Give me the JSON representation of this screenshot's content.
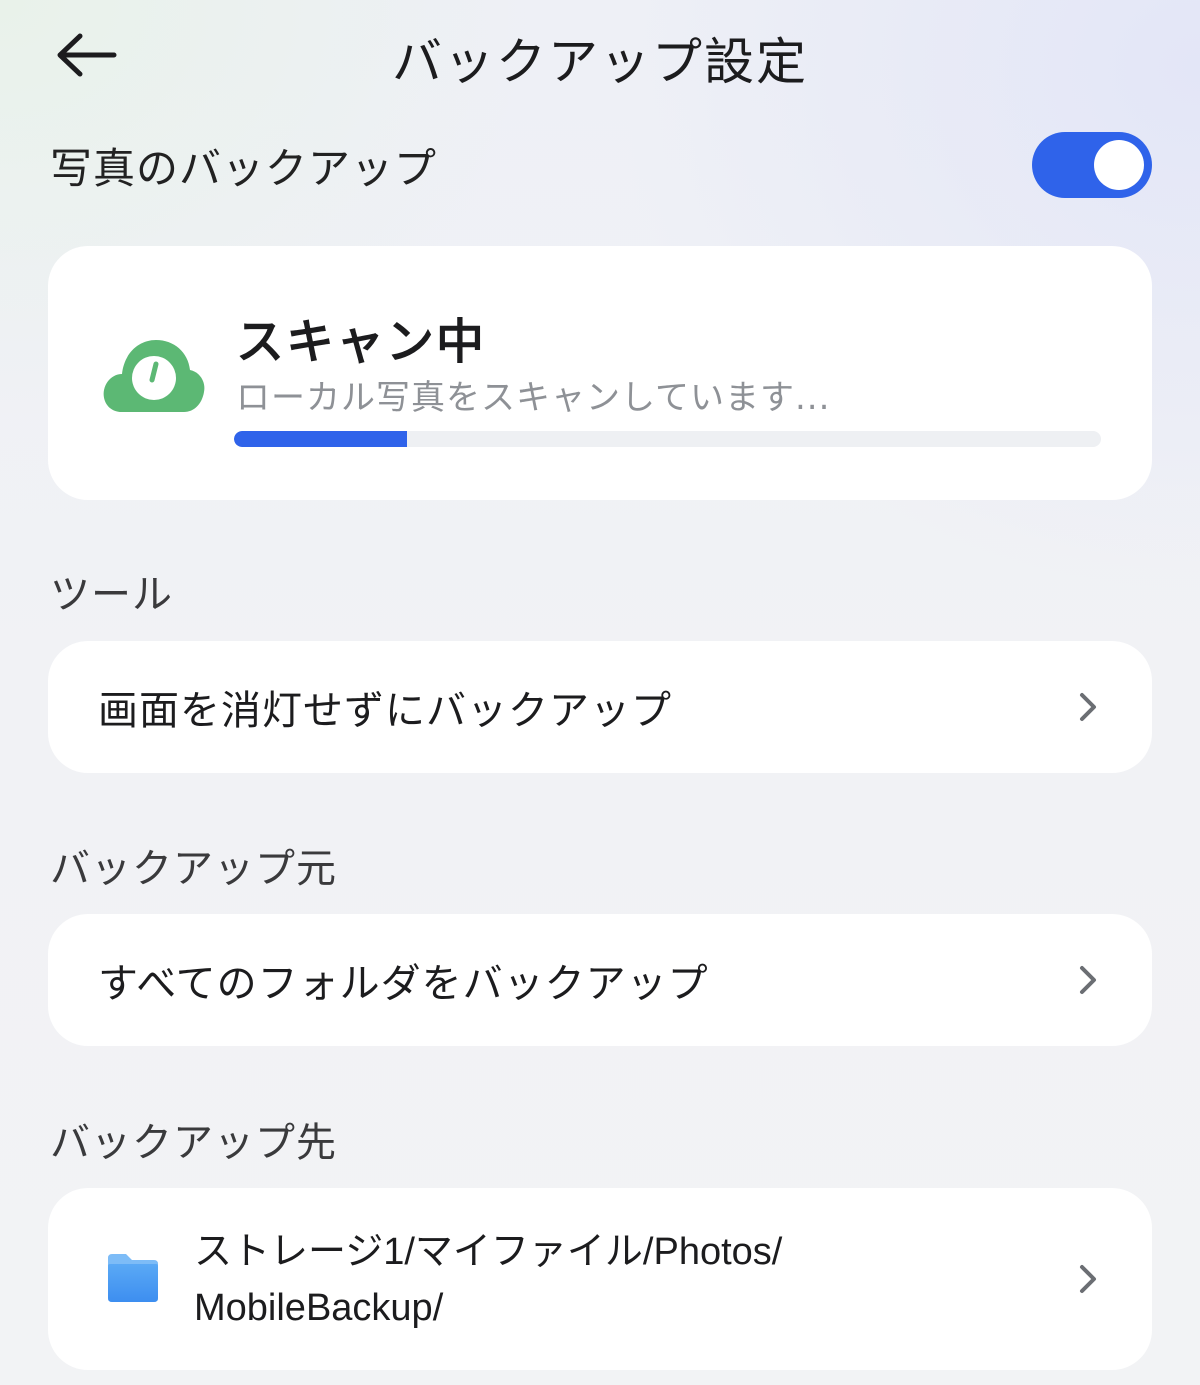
{
  "header": {
    "title": "バックアップ設定",
    "back_icon": "arrow-left-icon"
  },
  "photo_backup": {
    "label": "写真のバックアップ",
    "enabled": true,
    "accent": "#2f63ea"
  },
  "scan_status": {
    "title": "スキャン中",
    "subtitle": "ローカル写真をスキャンしています...",
    "progress": 0.2,
    "icon": "cloud-gauge-icon",
    "icon_color": "#5cb874"
  },
  "tools": {
    "section_label": "ツール",
    "items": [
      {
        "label": "画面を消灯せずにバックアップ"
      }
    ]
  },
  "source": {
    "section_label": "バックアップ元",
    "items": [
      {
        "label": "すべてのフォルダをバックアップ"
      }
    ]
  },
  "destination": {
    "section_label": "バックアップ先",
    "path_line1": "ストレージ1/マイファイル/Photos/",
    "path_line2": "MobileBackup/",
    "icon": "folder-icon"
  }
}
